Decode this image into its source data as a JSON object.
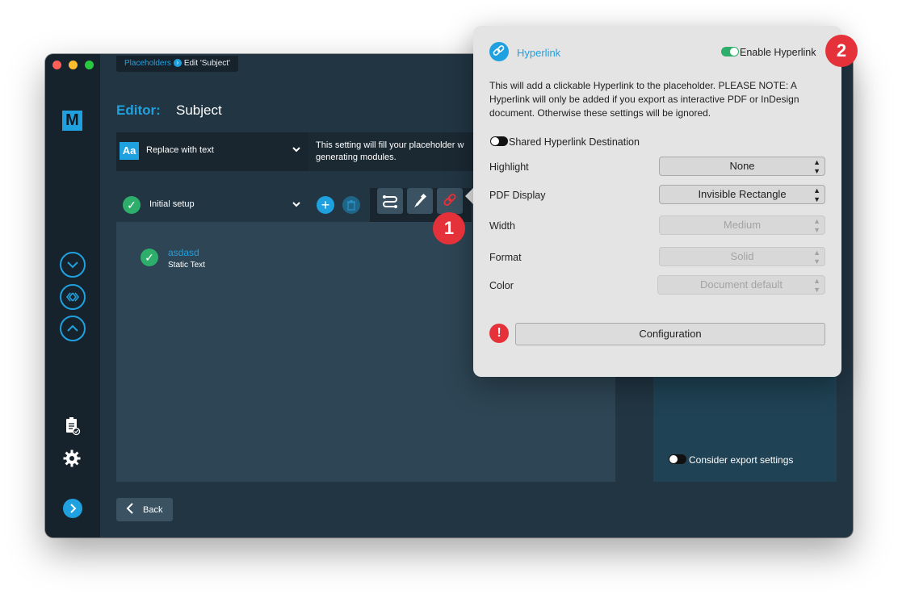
{
  "breadcrumb": {
    "parent": "Placeholders",
    "current": "Edit 'Subject'"
  },
  "logo": "M",
  "editor": {
    "label": "Editor:",
    "title": "Subject"
  },
  "replace": {
    "icon_text": "Aa",
    "label": "Replace with text"
  },
  "info": {
    "text": "This setting will fill your placeholder w\ngenerating modules."
  },
  "setup": {
    "label": "Initial setup"
  },
  "item": {
    "name": "asdasd",
    "type": "Static Text"
  },
  "right_panel": {
    "consider_label": "Consider export settings"
  },
  "back": {
    "label": "Back"
  },
  "badges": {
    "one": "1",
    "two": "2"
  },
  "popover": {
    "title": "Hyperlink",
    "enable_label": "Enable Hyperlink",
    "description": "This will add a clickable Hyperlink to the placeholder. PLEASE NOTE: A Hyperlink will only be added if you export as interactive PDF or InDesign document. Otherwise these settings will be ignored.",
    "shared_label": "Shared Hyperlink Destination",
    "rows": {
      "highlight": {
        "label": "Highlight",
        "value": "None"
      },
      "pdf_display": {
        "label": "PDF Display",
        "value": "Invisible Rectangle"
      },
      "width": {
        "label": "Width",
        "value": "Medium"
      },
      "format": {
        "label": "Format",
        "value": "Solid"
      },
      "color": {
        "label": "Color",
        "value": "Document default"
      }
    },
    "warning": "!",
    "configuration_label": "Configuration"
  },
  "colors": {
    "accent": "#1fa1e0",
    "success": "#2eae6b",
    "danger": "#e5323a"
  }
}
